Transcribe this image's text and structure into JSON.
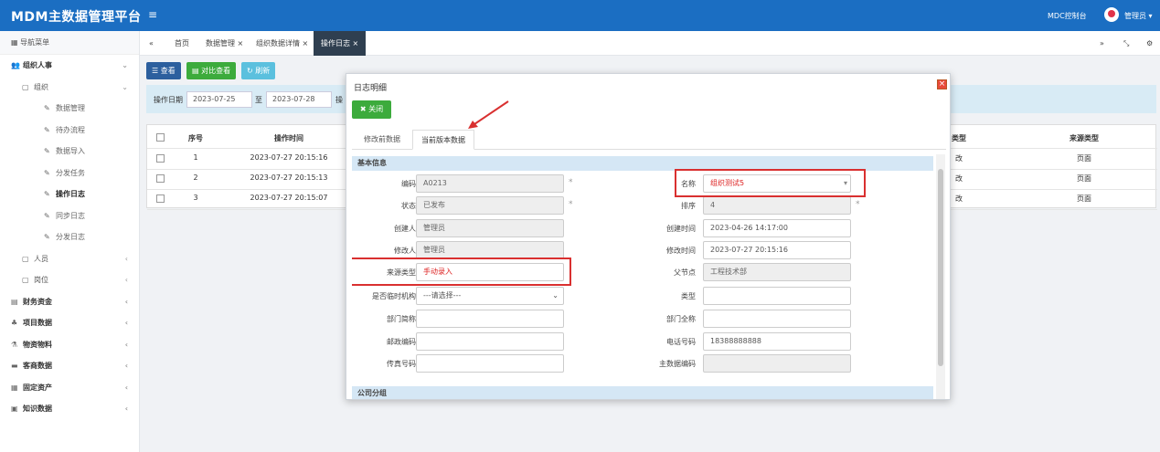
{
  "app": {
    "title": "MDM主数据管理平台",
    "menu_icon": "≡",
    "console": "MDC控制台",
    "user": "管理员"
  },
  "sidebar": {
    "header": "导航菜单",
    "groups": [
      {
        "label": "组织人事",
        "level": 1
      },
      {
        "label": "组织",
        "level": 2
      },
      {
        "label": "数据管理",
        "level": 3
      },
      {
        "label": "待办流程",
        "level": 3
      },
      {
        "label": "数据导入",
        "level": 3
      },
      {
        "label": "分发任务",
        "level": 3
      },
      {
        "label": "操作日志",
        "level": 3,
        "active": true
      },
      {
        "label": "同步日志",
        "level": 3
      },
      {
        "label": "分发日志",
        "level": 3
      },
      {
        "label": "人员",
        "level": 2
      },
      {
        "label": "岗位",
        "level": 2
      },
      {
        "label": "财务资金",
        "level": 1
      },
      {
        "label": "项目数据",
        "level": 1
      },
      {
        "label": "物资物料",
        "level": 1
      },
      {
        "label": "客商数据",
        "level": 1
      },
      {
        "label": "固定资产",
        "level": 1
      },
      {
        "label": "知识数据",
        "level": 1
      }
    ]
  },
  "tabs": [
    "首页",
    "数据管理",
    "组织数据详情",
    "操作日志"
  ],
  "toolbar": {
    "view": "查看",
    "compare": "对比查看",
    "refresh": "刷新"
  },
  "search": {
    "label": "操作日期",
    "from": "2023-07-25",
    "to_label": "至",
    "to": "2023-07-28",
    "op_label": "操"
  },
  "grid": {
    "headers": {
      "no": "序号",
      "time": "操作时间",
      "type": "类型",
      "source_type": "来源类型"
    },
    "rows": [
      {
        "no": "1",
        "time": "2023-07-27 20:15:16",
        "type": "改",
        "source": "页面"
      },
      {
        "no": "2",
        "time": "2023-07-27 20:15:13",
        "type": "改",
        "source": "页面"
      },
      {
        "no": "3",
        "time": "2023-07-27 20:15:07",
        "type": "改",
        "source": "页面"
      }
    ]
  },
  "modal": {
    "title": "日志明细",
    "close": "关闭",
    "tabs": [
      "修改前数据",
      "当前版本数据"
    ],
    "section_basic": "基本信息",
    "section_company": "公司分组",
    "fields": {
      "code": {
        "label": "编码",
        "value": "A0213"
      },
      "name": {
        "label": "名称",
        "value": "组织测试5"
      },
      "status": {
        "label": "状态",
        "value": "已发布"
      },
      "order": {
        "label": "排序",
        "value": "4"
      },
      "creator": {
        "label": "创建人",
        "value": "管理员"
      },
      "create_time": {
        "label": "创建时间",
        "value": "2023-04-26 14:17:00"
      },
      "modifier": {
        "label": "修改人",
        "value": "管理员"
      },
      "modify_time": {
        "label": "修改时间",
        "value": "2023-07-27 20:15:16"
      },
      "source_type": {
        "label": "来源类型",
        "value": "手动录入"
      },
      "parent": {
        "label": "父节点",
        "value": "工程技术部"
      },
      "temp_org": {
        "label": "是否临时机构",
        "value": "---请选择---"
      },
      "type": {
        "label": "类型",
        "value": ""
      },
      "dept_short": {
        "label": "部门简称",
        "value": ""
      },
      "dept_full": {
        "label": "部门全称",
        "value": ""
      },
      "postcode": {
        "label": "邮政编码",
        "value": ""
      },
      "phone": {
        "label": "电话号码",
        "value": "18388888888"
      },
      "fax": {
        "label": "传真号码",
        "value": ""
      },
      "master_code": {
        "label": "主数据编码",
        "value": ""
      }
    }
  },
  "colors": {
    "brand": "#1b6ec2",
    "highlight": "#d93030",
    "success": "#3cab3c"
  }
}
